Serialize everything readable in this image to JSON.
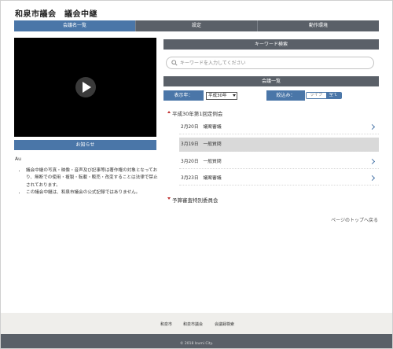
{
  "header": {
    "title": "和泉市議会　議会中継"
  },
  "nav": {
    "tabs": [
      {
        "label": "会議名一覧",
        "active": true
      },
      {
        "label": "設定",
        "active": false
      },
      {
        "label": "動作環境",
        "active": false
      }
    ]
  },
  "left": {
    "notice_label": "お知らせ",
    "notice_small": "Au",
    "notices": [
      "議会中継の写真・映像・音声及び記事等は著作権の対象となっており、無断での使用・複製・転載・販売・改変することは法律で禁止されております。",
      "この議会中継は、和泉市議会の公式記録ではありません。"
    ]
  },
  "right": {
    "keyword_header": "キーワード検索",
    "search_placeholder": "キーワードを入力してください",
    "meetings_header": "会議一覧",
    "year_label": "表示年：",
    "year_value": "平成30年",
    "narrow_label": "絞込み：",
    "filter_live": "ライブ",
    "filter_all": "全て",
    "session1": {
      "title": "平成30年第1回定例会",
      "rows": [
        {
          "label": "2月20日　議案審議"
        },
        {
          "label": "3月19日　一般質問"
        },
        {
          "label": "3月20日　一般質問"
        },
        {
          "label": "3月23日　議案審議"
        }
      ]
    },
    "session2": {
      "title": "予算審査特別委員会"
    },
    "to_top": "ページのトップへ戻る"
  },
  "footer": {
    "links": [
      "和泉市",
      "和泉市議会",
      "会議録検索"
    ],
    "copyright": "© 2018 Izumi City."
  },
  "colors": {
    "accent": "#4a76a8",
    "header_bar": "#5a6068"
  }
}
